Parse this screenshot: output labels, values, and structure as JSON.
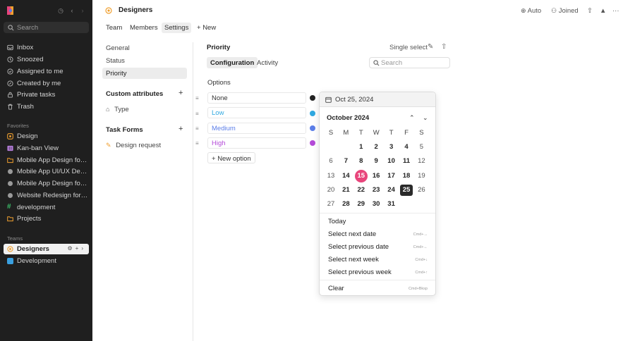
{
  "sidebar": {
    "search_placeholder": "Search",
    "nav": [
      {
        "label": "Inbox",
        "icon": "inbox-icon"
      },
      {
        "label": "Snoozed",
        "icon": "clock-icon"
      },
      {
        "label": "Assigned to me",
        "icon": "assigned-icon"
      },
      {
        "label": "Created by me",
        "icon": "pencil-icon"
      },
      {
        "label": "Private tasks",
        "icon": "lock-icon"
      },
      {
        "label": "Trash",
        "icon": "trash-icon"
      }
    ],
    "favorites_label": "Favorites",
    "favorites": [
      {
        "label": "Design",
        "color": "#f0a030"
      },
      {
        "label": "Kan-ban View",
        "color": "#b57edc"
      },
      {
        "label": "Mobile App Design for Real Estate",
        "color": "#f0a030"
      },
      {
        "label": "Mobile App UI/UX Design",
        "color": "#9a9a9a"
      },
      {
        "label": "Mobile App Design for Fitness",
        "color": "#9a9a9a"
      },
      {
        "label": "Website Redesign for agency",
        "color": "#9a9a9a"
      },
      {
        "label": "development",
        "color": "#3bbf6a"
      },
      {
        "label": "Projects",
        "color": "#f0a030"
      }
    ],
    "teams_label": "Teams",
    "teams": [
      {
        "label": "Designers",
        "color": "#f0a030"
      },
      {
        "label": "Development",
        "color": "#3aa0e0"
      }
    ]
  },
  "header": {
    "title": "Designers",
    "auto_label": "Auto",
    "joined_label": "Joined",
    "tabs": [
      "Team",
      "Members",
      "Settings"
    ],
    "new_label": "New"
  },
  "settings_nav": {
    "items": [
      "General",
      "Status",
      "Priority"
    ],
    "custom_attributes": "Custom attributes",
    "type_label": "Type",
    "task_forms": "Task Forms",
    "design_request": "Design request"
  },
  "main": {
    "title": "Priority",
    "single_select": "Single select",
    "subtabs": [
      "Configuration",
      "Activity"
    ],
    "search_placeholder": "Search",
    "options_label": "Options",
    "options": [
      {
        "label": "None",
        "color": "#222222",
        "text_color": "#333333"
      },
      {
        "label": "Low",
        "color": "#2fa8e0",
        "text_color": "#2fa8e0"
      },
      {
        "label": "Medium",
        "color": "#5b7ee8",
        "text_color": "#5b7ee8"
      },
      {
        "label": "High",
        "color": "#b44ad8",
        "text_color": "#b44ad8"
      }
    ],
    "new_option": "New option"
  },
  "datepicker": {
    "input_value": "Oct 25, 2024",
    "month_label": "October 2024",
    "weekdays": [
      "S",
      "M",
      "T",
      "W",
      "T",
      "F",
      "S"
    ],
    "weeks": [
      [
        "",
        "",
        "1",
        "2",
        "3",
        "4",
        "5"
      ],
      [
        "6",
        "7",
        "8",
        "9",
        "10",
        "11",
        "12"
      ],
      [
        "13",
        "14",
        "15",
        "16",
        "17",
        "18",
        "19"
      ],
      [
        "20",
        "21",
        "22",
        "23",
        "24",
        "25",
        "26"
      ],
      [
        "27",
        "28",
        "29",
        "30",
        "31",
        "",
        ""
      ]
    ],
    "today": "15",
    "selected": "25",
    "actions": [
      {
        "label": "Today",
        "shortcut": ""
      },
      {
        "label": "Select next date",
        "shortcut": "Cmd+→"
      },
      {
        "label": "Select previous date",
        "shortcut": "Cmd+←"
      },
      {
        "label": "Select next week",
        "shortcut": "Cmd+↓"
      },
      {
        "label": "Select previous week",
        "shortcut": "Cmd+↑"
      }
    ],
    "clear_label": "Clear",
    "clear_shortcut": "Cmd+Bksp"
  }
}
